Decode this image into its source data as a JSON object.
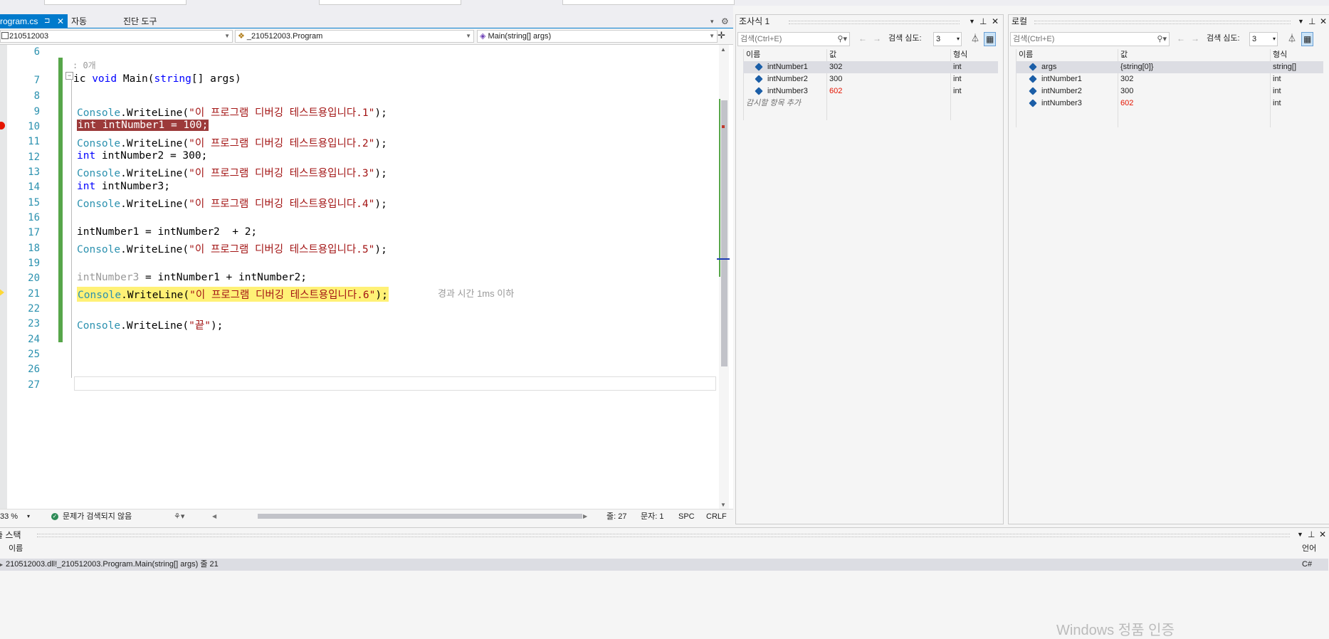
{
  "tabs": {
    "active_file": "rogram.cs",
    "pin_glyph": "⊐",
    "close_glyph": "✕",
    "tab2": "자동",
    "tab3": "진단 도구"
  },
  "nav": {
    "project": "210512003",
    "class": "_210512003.Program",
    "method": "Main(string[] args)"
  },
  "editor": {
    "codelens": "0개",
    "lines": [
      {
        "num": "6"
      },
      {
        "num": "7"
      },
      {
        "num": "8"
      },
      {
        "num": "9"
      },
      {
        "num": "10"
      },
      {
        "num": "11"
      },
      {
        "num": "12"
      },
      {
        "num": "13"
      },
      {
        "num": "14"
      },
      {
        "num": "15"
      },
      {
        "num": "16"
      },
      {
        "num": "17"
      },
      {
        "num": "18"
      },
      {
        "num": "19"
      },
      {
        "num": "20"
      },
      {
        "num": "21"
      },
      {
        "num": "22"
      },
      {
        "num": "23"
      },
      {
        "num": "24"
      },
      {
        "num": "25"
      },
      {
        "num": "26"
      },
      {
        "num": "27"
      }
    ],
    "code": {
      "l7a": "ic ",
      "l7b": "void",
      "l7c": " Main(",
      "l7d": "string",
      "l7e": "[] args)",
      "console": "Console",
      "writeline": ".WriteLine(",
      "s1": "\"이 프로그램 디버깅 테스트용입니다.1\"",
      "s2": "\"이 프로그램 디버깅 테스트용입니다.2\"",
      "s3": "\"이 프로그램 디버깅 테스트용입니다.3\"",
      "s4": "\"이 프로그램 디버깅 테스트용입니다.4\"",
      "s5": "\"이 프로그램 디버깅 테스트용입니다.5\"",
      "s6": "\"이 프로그램 디버깅 테스트용입니다.6\"",
      "s_end": "\"끝\"",
      "close": ");",
      "l10": "int intNumber1 = 100;",
      "kw_int": "int",
      "l12": " intNumber2 = 300;",
      "l14": " intNumber3;",
      "l17": "intNumber1 = intNumber2  + 2;",
      "l20a": "intNumber3",
      "l20b": " = intNumber1 + intNumber2;",
      "elapsed": "경과 시간 1ms 이하"
    }
  },
  "status": {
    "zoom": "33 %",
    "issues": "문제가 검색되지 않음",
    "line": "줄: 27",
    "char": "문자: 1",
    "spc": "SPC",
    "crlf": "CRLF"
  },
  "watch": {
    "title": "조사식 1",
    "search_placeholder": "검색(Ctrl+E)",
    "depth_label": "검색 심도:",
    "depth_value": "3",
    "col_name": "이름",
    "col_value": "값",
    "col_type": "형식",
    "rows": [
      {
        "name": "intNumber1",
        "value": "302",
        "type": "int"
      },
      {
        "name": "intNumber2",
        "value": "300",
        "type": "int"
      },
      {
        "name": "intNumber3",
        "value": "602",
        "type": "int"
      }
    ],
    "add_item": "감시할 항목 추가"
  },
  "locals": {
    "title": "로컬",
    "search_placeholder": "검색(Ctrl+E)",
    "depth_label": "검색 심도:",
    "depth_value": "3",
    "col_name": "이름",
    "col_value": "값",
    "col_type": "형식",
    "rows": [
      {
        "name": "args",
        "value": "{string[0]}",
        "type": "string[]"
      },
      {
        "name": "intNumber1",
        "value": "302",
        "type": "int"
      },
      {
        "name": "intNumber2",
        "value": "300",
        "type": "int"
      },
      {
        "name": "intNumber3",
        "value": "602",
        "type": "int"
      }
    ]
  },
  "callstack": {
    "title": "호출 스택",
    "col_name": "이름",
    "col_lang": "언어",
    "frame": "210512003.dll!_210512003.Program.Main(string[] args) 줄 21",
    "lang": "C#"
  },
  "watermark": "Windows 정품 인증",
  "colors": {
    "accent": "#007acc",
    "string": "#a31515",
    "keyword": "#0000ff",
    "type": "#2b91af",
    "breakpoint": "#e51400",
    "current_line": "#fff176",
    "changed_value": "#e51400"
  }
}
